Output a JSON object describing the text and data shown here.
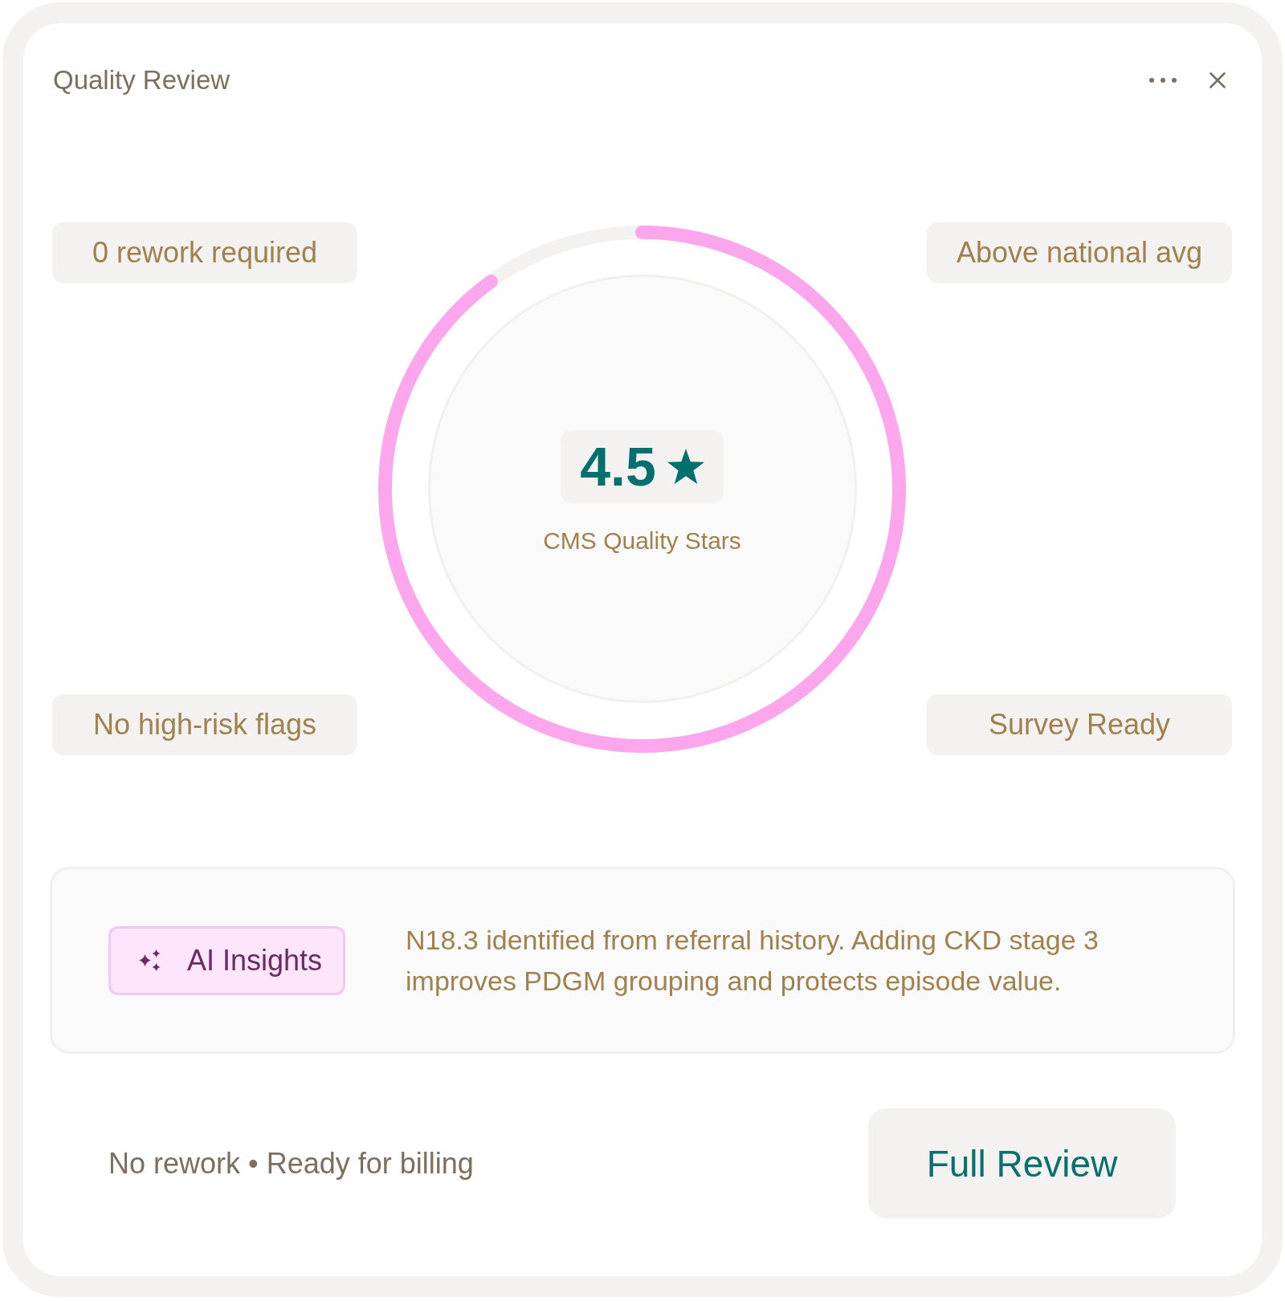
{
  "window": {
    "title": "Quality Review"
  },
  "chips": [
    "0 rework required",
    "Above national avg",
    "No high-risk flags",
    "Survey Ready"
  ],
  "score": {
    "value": "4.5",
    "label": "CMS Quality Stars",
    "level": 0.9
  },
  "insight": {
    "button": "AI Insights",
    "text": "N18.3 identified from referral history. Adding CKD stage 3 improves PDGM grouping and protects episode value."
  },
  "footer": {
    "status": "No rework • Ready for billing",
    "button": "Full Review"
  }
}
